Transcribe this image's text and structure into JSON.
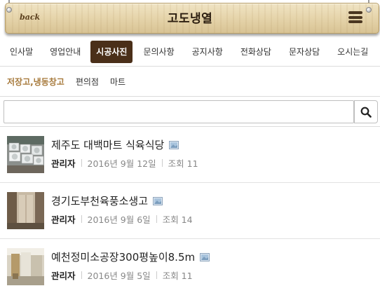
{
  "header": {
    "back_label": "back",
    "title": "고도냉열",
    "menu_icon": "hamburger-icon"
  },
  "main_nav": [
    {
      "label": "인사말",
      "active": false
    },
    {
      "label": "영업안내",
      "active": false
    },
    {
      "label": "시공사진",
      "active": true
    },
    {
      "label": "문의사항",
      "active": false
    },
    {
      "label": "공지사항",
      "active": false
    },
    {
      "label": "전화상담",
      "active": false
    },
    {
      "label": "문자상담",
      "active": false
    },
    {
      "label": "오시는길",
      "active": false
    }
  ],
  "sub_nav": [
    {
      "label": "저장고,냉동창고",
      "active": true
    },
    {
      "label": "편의점",
      "active": false
    },
    {
      "label": "마트",
      "active": false
    }
  ],
  "search": {
    "value": "",
    "placeholder": "",
    "button_icon": "search-icon"
  },
  "posts": [
    {
      "title": "제주도 대백마트 식육식당",
      "author": "관리자",
      "date": "2016년 9월 12일",
      "views": "조회 11"
    },
    {
      "title": "경기도부천육풍소생고",
      "author": "관리자",
      "date": "2016년 9월 6일",
      "views": "조회 14"
    },
    {
      "title": "예천정미소공장300평높이8.5m",
      "author": "관리자",
      "date": "2016년 9월 5일",
      "views": "조회 11"
    }
  ],
  "colors": {
    "nav_active_bg": "#4a2f19",
    "sub_active_text": "#a77a3c",
    "board_wood": "#e7d6ad"
  }
}
